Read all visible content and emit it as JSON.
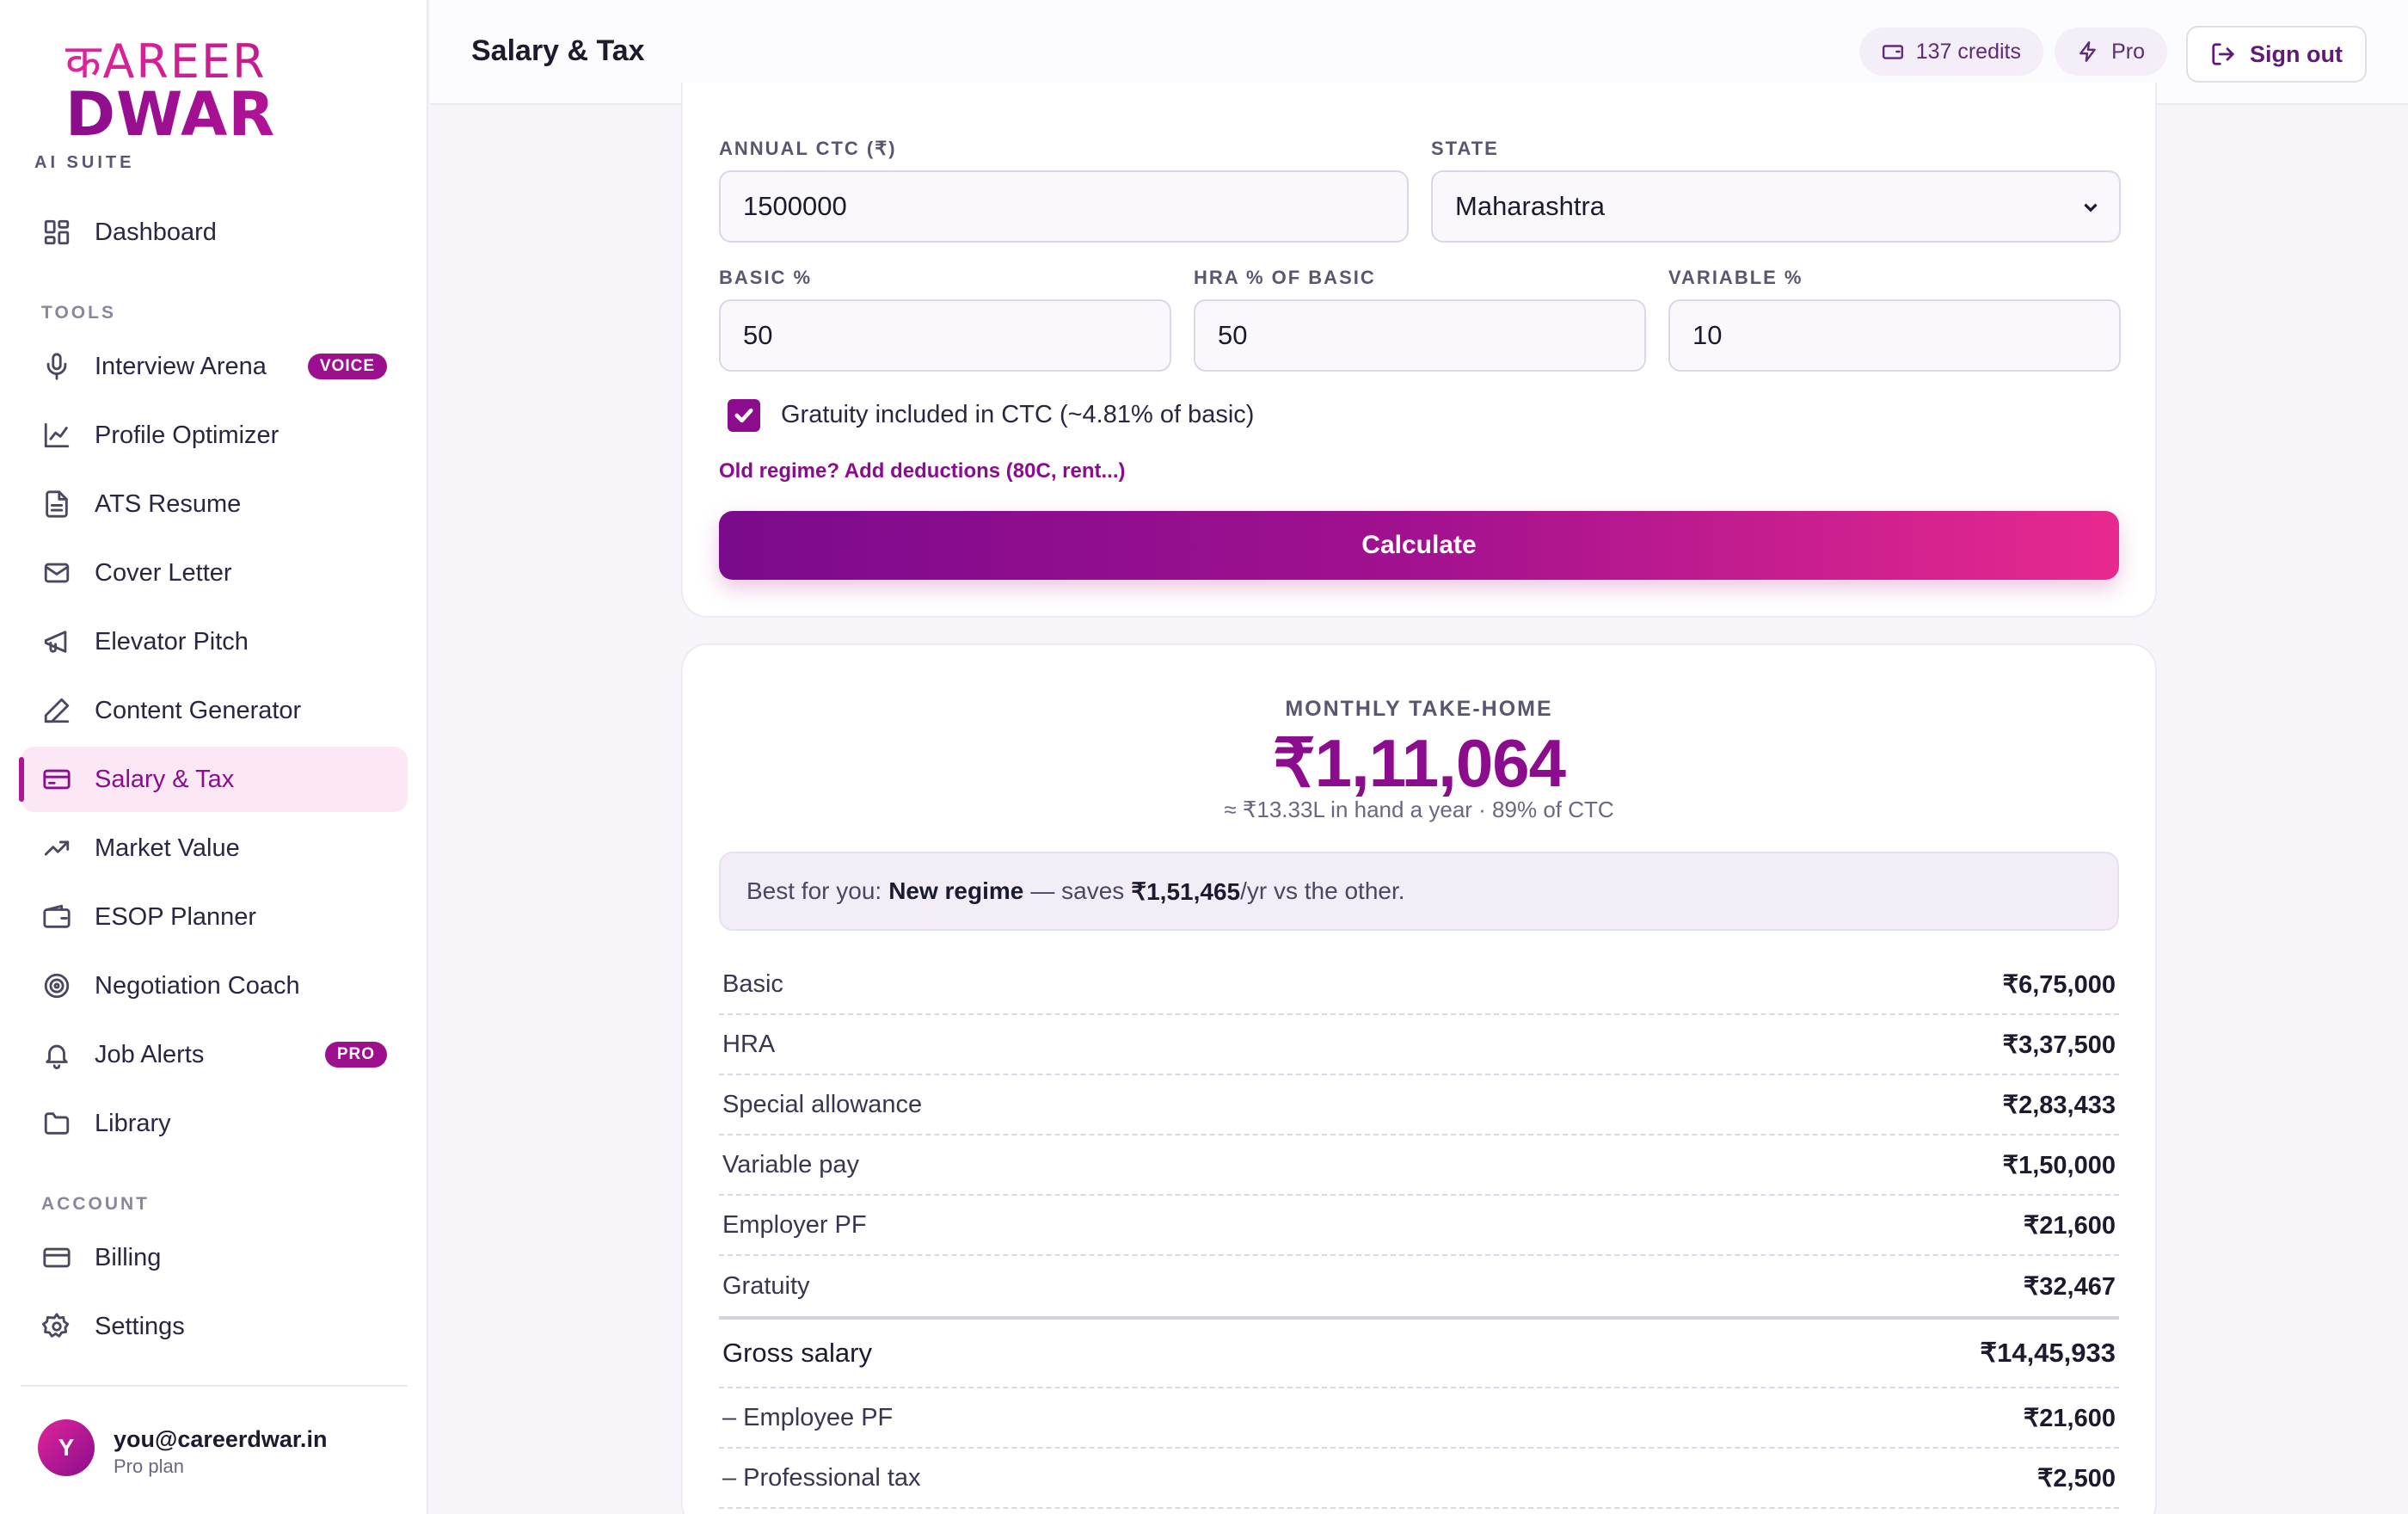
{
  "brand": {
    "line1": "कAREER",
    "line2": "DWAR",
    "subtitle": "AI SUITE"
  },
  "sidebar": {
    "dashboard": "Dashboard",
    "tools_label": "TOOLS",
    "tools": [
      {
        "label": "Interview Arena",
        "icon": "mic-icon",
        "badge": "VOICE"
      },
      {
        "label": "Profile Optimizer",
        "icon": "chart-icon"
      },
      {
        "label": "ATS Resume",
        "icon": "file-icon"
      },
      {
        "label": "Cover Letter",
        "icon": "mail-icon"
      },
      {
        "label": "Elevator Pitch",
        "icon": "megaphone-icon"
      },
      {
        "label": "Content Generator",
        "icon": "pen-icon"
      },
      {
        "label": "Salary & Tax",
        "icon": "card-icon",
        "active": true
      },
      {
        "label": "Market Value",
        "icon": "trend-icon"
      },
      {
        "label": "ESOP Planner",
        "icon": "wallet-icon"
      },
      {
        "label": "Negotiation Coach",
        "icon": "target-icon"
      },
      {
        "label": "Job Alerts",
        "icon": "bell-icon",
        "badge": "PRO"
      },
      {
        "label": "Library",
        "icon": "folder-icon"
      }
    ],
    "account_label": "ACCOUNT",
    "account": [
      {
        "label": "Billing",
        "icon": "billing-icon"
      },
      {
        "label": "Settings",
        "icon": "gear-icon"
      }
    ],
    "user": {
      "initial": "Y",
      "email": "you@careerdwar.in",
      "plan": "Pro plan"
    }
  },
  "header": {
    "title": "Salary & Tax",
    "credits": "137 credits",
    "plan": "Pro",
    "signout": "Sign out"
  },
  "form": {
    "ctc_label": "ANNUAL CTC (₹)",
    "ctc_value": "1500000",
    "state_label": "STATE",
    "state_value": "Maharashtra",
    "basic_label": "BASIC %",
    "basic_value": "50",
    "hra_label": "HRA % OF BASIC",
    "hra_value": "50",
    "variable_label": "VARIABLE %",
    "variable_value": "10",
    "gratuity_label": "Gratuity included in CTC (~4.81% of basic)",
    "gratuity_checked": true,
    "old_regime_link": "Old regime? Add deductions (80C, rent...)",
    "calculate": "Calculate"
  },
  "result": {
    "label": "MONTHLY TAKE-HOME",
    "value": "₹1,11,064",
    "sub": "≈ ₹13.33L in hand a year · 89% of CTC",
    "best_prefix": "Best for you:",
    "best_regime": "New regime",
    "best_mid": "— saves",
    "best_amount": "₹1,51,465",
    "best_suffix": "/yr vs the other.",
    "rows": [
      {
        "k": "Basic",
        "v": "₹6,75,000"
      },
      {
        "k": "HRA",
        "v": "₹3,37,500"
      },
      {
        "k": "Special allowance",
        "v": "₹2,83,433"
      },
      {
        "k": "Variable pay",
        "v": "₹1,50,000"
      },
      {
        "k": "Employer PF",
        "v": "₹21,600"
      },
      {
        "k": "Gratuity",
        "v": "₹32,467"
      },
      {
        "k": "Gross salary",
        "v": "₹14,45,933"
      },
      {
        "k": "– Employee PF",
        "v": "₹21,600"
      },
      {
        "k": "– Professional tax",
        "v": "₹2,500"
      }
    ]
  },
  "colors": {
    "accent": "#8b0c8c",
    "accent_pink": "#e8298f",
    "active_bg": "#fbe8f4"
  }
}
